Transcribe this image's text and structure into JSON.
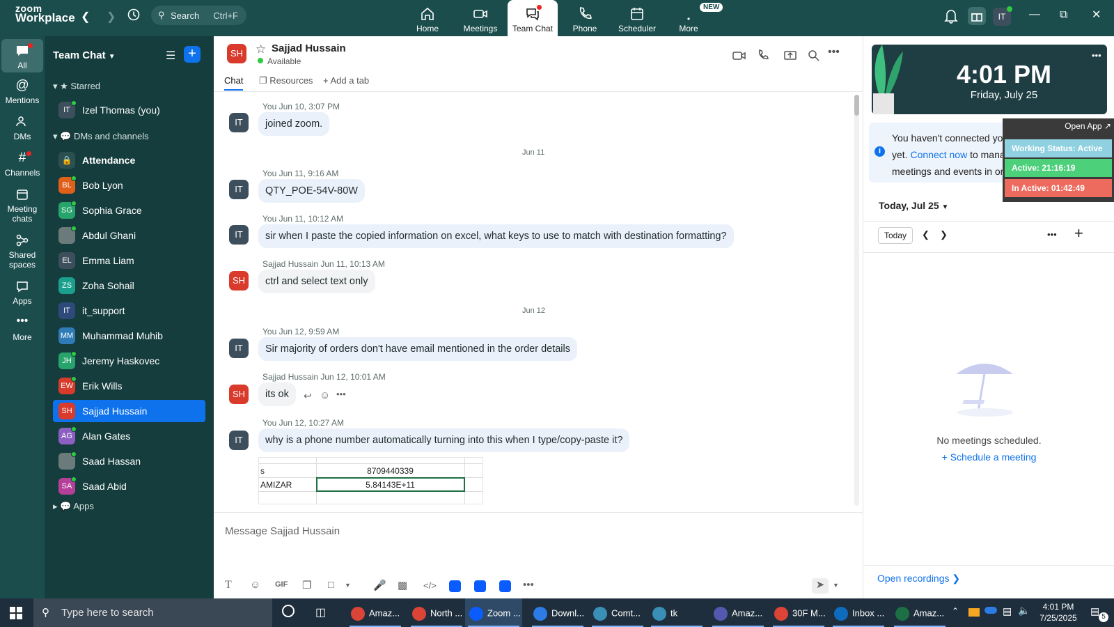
{
  "app": {
    "logo_line1": "zoom",
    "logo_line2": "Workplace"
  },
  "search": {
    "placeholder": "Search",
    "shortcut": "Ctrl+F"
  },
  "nav": {
    "tabs": [
      {
        "label": "Home"
      },
      {
        "label": "Meetings"
      },
      {
        "label": "Team Chat"
      },
      {
        "label": "Phone"
      },
      {
        "label": "Scheduler"
      },
      {
        "label": "More"
      }
    ],
    "new_badge": "NEW",
    "avatar_initials": "IT"
  },
  "rail": {
    "items": [
      {
        "label": "All"
      },
      {
        "label": "Mentions"
      },
      {
        "label": "DMs"
      },
      {
        "label": "Channels"
      },
      {
        "label": "Meeting chats"
      },
      {
        "label": "Shared spaces"
      },
      {
        "label": "Apps"
      },
      {
        "label": "More"
      }
    ]
  },
  "sidebar": {
    "title": "Team Chat",
    "starred_label": "Starred",
    "dms_label": "DMs and channels",
    "apps_label": "Apps",
    "starred": [
      {
        "initials": "IT",
        "name": "Izel Thomas (you)",
        "color": "#3d4f5c"
      }
    ],
    "contacts": [
      {
        "initials": "",
        "name": "Attendance",
        "color": "#2c5050"
      },
      {
        "initials": "BL",
        "name": "Bob Lyon",
        "color": "#e0601a"
      },
      {
        "initials": "SG",
        "name": "Sophia Grace",
        "color": "#27a36c"
      },
      {
        "initials": "",
        "name": "Abdul Ghani",
        "color": "#6b7a7a"
      },
      {
        "initials": "EL",
        "name": "Emma Liam",
        "color": "#3d4f5c"
      },
      {
        "initials": "ZS",
        "name": "Zoha Sohail",
        "color": "#1ca08e"
      },
      {
        "initials": "IT",
        "name": "it_support",
        "color": "#2e4a7a"
      },
      {
        "initials": "MM",
        "name": "Muhammad Muhib",
        "color": "#2f7bb8"
      },
      {
        "initials": "JH",
        "name": "Jeremy Haskovec",
        "color": "#27a36c"
      },
      {
        "initials": "EW",
        "name": "Erik Wills",
        "color": "#d93a2b"
      },
      {
        "initials": "SH",
        "name": "Sajjad Hussain",
        "color": "#d93a2b"
      },
      {
        "initials": "AG",
        "name": "Alan Gates",
        "color": "#8e5fc2"
      },
      {
        "initials": "",
        "name": "Saad Hassan",
        "color": "#6b7a7a"
      },
      {
        "initials": "SA",
        "name": "Saad Abid",
        "color": "#b5409a"
      }
    ]
  },
  "chat": {
    "contact_initials": "SH",
    "contact_name": "Sajjad Hussain",
    "status": "Available",
    "tabs": {
      "chat": "Chat",
      "resources": "Resources",
      "add": "Add a tab"
    },
    "dates": {
      "d1": "Jun 11",
      "d2": "Jun 12"
    },
    "messages": [
      {
        "initials": "IT",
        "meta": "You Jun 10, 3:07 PM",
        "text": "joined zoom."
      },
      {
        "initials": "IT",
        "meta": "You Jun 11, 9:16 AM",
        "text": "QTY_POE-54V-80W"
      },
      {
        "initials": "IT",
        "meta": "You Jun 11, 10:12 AM",
        "text": "sir when I paste the copied information on excel, what keys to use to match with destination formatting?"
      },
      {
        "initials": "SH",
        "meta": "Sajjad Hussain Jun 11, 10:13 AM",
        "text": "ctrl and select text only"
      },
      {
        "initials": "IT",
        "meta": "You Jun 12, 9:59 AM",
        "text": "Sir majority of orders don't have email mentioned in the order details"
      },
      {
        "initials": "SH",
        "meta": "Sajjad Hussain Jun 12, 10:01 AM",
        "text": "its ok"
      },
      {
        "initials": "IT",
        "meta": "You Jun 12, 10:27 AM",
        "text": "why is a phone number automatically turning into this when I type/copy-paste it?"
      }
    ],
    "sheet": {
      "r1c1": "s",
      "r1c2": "8709440339",
      "r2c1": "AMIZAR",
      "r2c2": "5.84143E+11"
    },
    "composer_placeholder": "Message Sajjad Hussain",
    "gif_label": "GIF"
  },
  "calendar": {
    "time": "4:01 PM",
    "date": "Friday, July 25",
    "notice_pre": "You haven't connected your calendar yet.",
    "notice_link": "Connect now",
    "notice_post": "to manage all your meetings and events in one place.",
    "today_heading": "Today, Jul 25",
    "today_button": "Today",
    "empty_text": "No meetings scheduled.",
    "schedule_link": "Schedule a meeting",
    "open_recordings": "Open recordings"
  },
  "overlay": {
    "open_app": "Open App ↗",
    "working": "Working Status: Active",
    "active": "Active: 21:16:19",
    "inactive": "In Active: 01:42:49"
  },
  "taskbar": {
    "search_placeholder": "Type here to search",
    "apps": [
      {
        "label": "Amaz...",
        "color": "#db4437"
      },
      {
        "label": "North ...",
        "color": "#db4437"
      },
      {
        "label": "Zoom ...",
        "color": "#0b5cff"
      },
      {
        "label": "Downl...",
        "color": "#2d7be5"
      },
      {
        "label": "Comt...",
        "color": "#3a8fb7"
      },
      {
        "label": "tk",
        "color": "#3a8fb7"
      },
      {
        "label": "Amaz...",
        "color": "#5558af"
      },
      {
        "label": "30F M...",
        "color": "#db4437"
      },
      {
        "label": "Inbox ...",
        "color": "#0f6cbd"
      },
      {
        "label": "Amaz...",
        "color": "#1d7044"
      }
    ],
    "time": "4:01 PM",
    "date": "7/25/2025",
    "notif_count": "5"
  },
  "colors": {
    "accent": "#0e72ed",
    "topbar": "#1b4d4d",
    "sidebar": "#163d3d",
    "bubble": "#eaf1fb"
  }
}
